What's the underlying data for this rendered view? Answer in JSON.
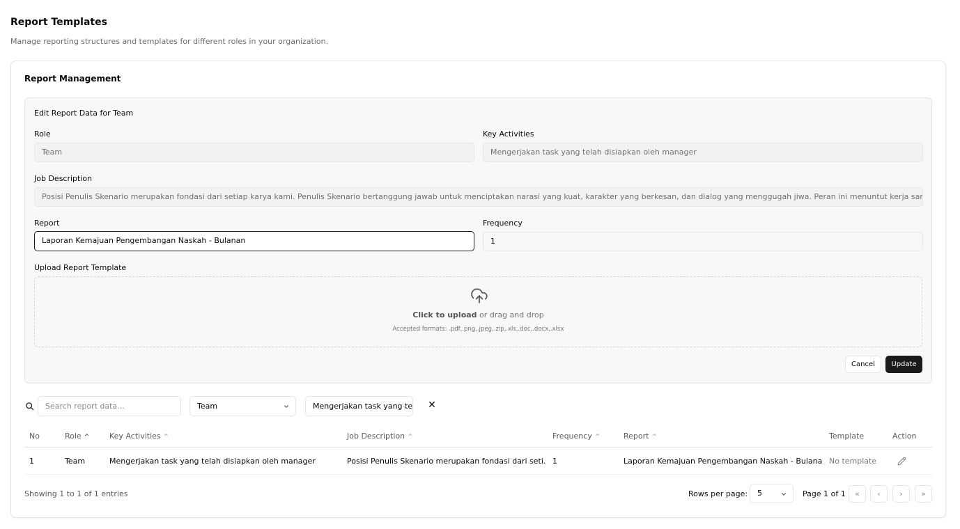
{
  "page": {
    "title": "Report Templates",
    "subtitle": "Manage reporting structures and templates for different roles in your organization."
  },
  "card": {
    "title": "Report Management"
  },
  "edit_form": {
    "title": "Edit Report Data for Team",
    "role_label": "Role",
    "role_value": "Team",
    "key_activities_label": "Key Activities",
    "key_activities_value": "Mengerjakan task yang telah disiapkan oleh manager",
    "job_description_label": "Job Description",
    "job_description_value": "Posisi Penulis Skenario merupakan fondasi dari setiap karya kami. Penulis Skenario bertanggung jawab untuk menciptakan narasi yang kuat, karakter yang berkesan, dan dialog yang menggugah jiwa. Peran ini menuntut kerja sama yang e",
    "report_label": "Report",
    "report_value": "Laporan Kemajuan Pengembangan Naskah - Bulanan",
    "frequency_label": "Frequency",
    "frequency_value": "1",
    "upload_label": "Upload Report Template",
    "upload_click": "Click to upload",
    "upload_rest": " or drag and drop",
    "upload_formats": "Accepted formats: .pdf,.png,.jpeg,.zip,.xls,.doc,.docx,.xlsx",
    "cancel_label": "Cancel",
    "update_label": "Update"
  },
  "filters": {
    "search_placeholder": "Search report data...",
    "role_selected": "Team",
    "activity_selected": "Mengerjakan task yang telah disiapkan oleh manager",
    "clear_symbol": "✕"
  },
  "table": {
    "columns": [
      "No",
      "Role",
      "Key Activities",
      "Job Description",
      "Frequency",
      "Report",
      "Template",
      "Action"
    ],
    "rows": [
      {
        "no": "1",
        "role": "Team",
        "key_activities": "Mengerjakan task yang telah disiapkan oleh manager",
        "job_description": "Posisi Penulis Skenario merupakan fondasi dari seti…",
        "frequency": "1",
        "report": "Laporan Kemajuan Pengembangan Naskah - Bulanan",
        "template": "No template"
      }
    ]
  },
  "pagination": {
    "showing": "Showing 1 to 1 of 1 entries",
    "rows_per_page_label": "Rows per page:",
    "rows_per_page_value": "5",
    "page_info": "Page 1 of 1",
    "first": "«",
    "prev": "‹",
    "next": "›",
    "last": "»"
  },
  "colors": {
    "primary": "#1a1a1a",
    "border": "#e5e5e5",
    "muted_text": "#6b6b6b"
  },
  "icons": [
    "upload-cloud-icon",
    "search-icon",
    "chevron-down-icon",
    "close-icon",
    "pencil-icon",
    "sort-up-icon"
  ]
}
